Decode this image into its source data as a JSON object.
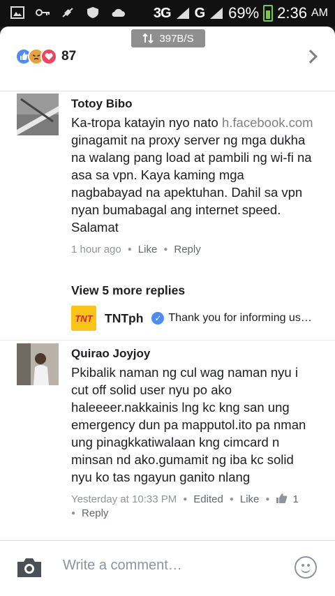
{
  "status_bar": {
    "network": "3G",
    "sim2_label": "G",
    "battery_percent": "69%",
    "time": "2:36",
    "ampm": "AM"
  },
  "net_speed": "397B/S",
  "reactions": {
    "count": "87",
    "types": [
      "like-icon",
      "angry-icon",
      "love-icon"
    ]
  },
  "comments": [
    {
      "author": "Totoy Bibo",
      "text_before_link": "Ka-tropa katayin nyo nato ",
      "link": "h.facebook.com",
      "text_after_link": " ginagamit na proxy server ng mga dukha na walang pang load at pambili ng wi-fi na asa sa vpn. Kaya kaming mga nagbabayad na apektuhan. Dahil sa vpn nyan bumabagal ang internet speed. Salamat",
      "time": "1 hour ago",
      "like": "Like",
      "reply": "Reply"
    },
    {
      "author": "Quirao Joyjoy",
      "text": "Pkibalik naman ng cul wag naman nyu i cut off solid user nyu po ako haleeeer.nakkainis lng kc kng san ung emergency dun pa mapputol.ito pa nman ung pinagkkatiwalaan kng cimcard n minsan nd ako.gumamit ng iba kc solid nyu ko tas ngayun ganito nlang",
      "time": "Yesterday at 10:33 PM",
      "edited": "Edited",
      "like": "Like",
      "like_count": "1",
      "reply": "Reply"
    }
  ],
  "more_replies": "View 5 more replies",
  "reply_preview": {
    "logo_text": "TNT",
    "name": "TNTph",
    "text": "Thank you for informing us…"
  },
  "composer": {
    "placeholder": "Write a comment…"
  }
}
